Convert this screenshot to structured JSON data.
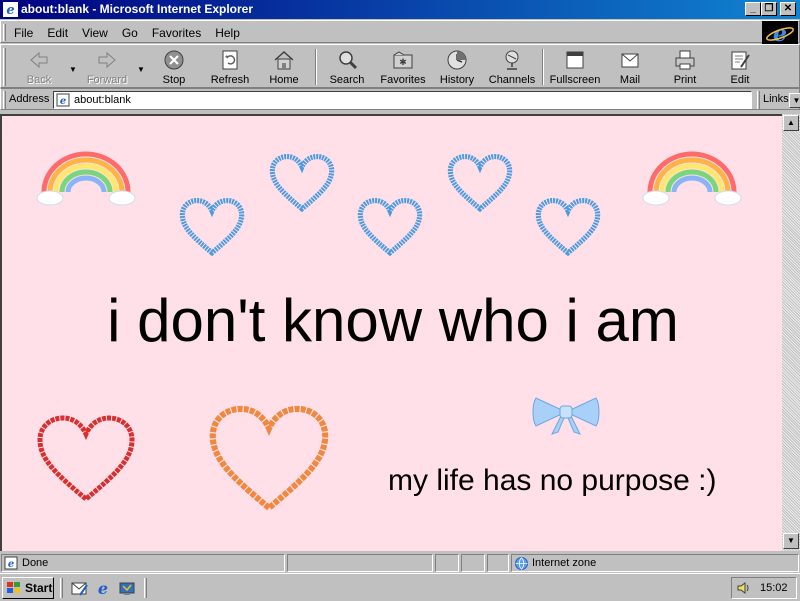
{
  "window": {
    "title": "about:blank - Microsoft Internet Explorer"
  },
  "menu": [
    {
      "label": "File"
    },
    {
      "label": "Edit"
    },
    {
      "label": "View"
    },
    {
      "label": "Go"
    },
    {
      "label": "Favorites"
    },
    {
      "label": "Help"
    }
  ],
  "toolbar": {
    "back": "Back",
    "forward": "Forward",
    "stop": "Stop",
    "refresh": "Refresh",
    "home": "Home",
    "search": "Search",
    "favorites": "Favorites",
    "history": "History",
    "channels": "Channels",
    "fullscreen": "Fullscreen",
    "mail": "Mail",
    "print": "Print",
    "edit": "Edit"
  },
  "address": {
    "label": "Address",
    "value": "about:blank",
    "links": "Links"
  },
  "page": {
    "headline": "i don't know who i am",
    "subline": "my life has no purpose :)"
  },
  "status": {
    "text": "Done",
    "zone": "Internet zone"
  },
  "taskbar": {
    "start": "Start",
    "clock": "15:02"
  },
  "colors": {
    "title_start": "#000080",
    "title_end": "#1084d0",
    "page_bg": "#ffe0e8",
    "heart_blue": "#4a9be0",
    "heart_red": "#d83030",
    "heart_orange": "#f08840",
    "bow": "#a8d0f8"
  },
  "icons": [
    "ie-icon",
    "minimize-icon",
    "maximize-icon",
    "close-icon",
    "back-arrow-icon",
    "forward-arrow-icon",
    "stop-icon",
    "refresh-icon",
    "home-icon",
    "search-icon",
    "favorites-icon",
    "history-icon",
    "channels-icon",
    "fullscreen-icon",
    "mail-icon",
    "print-icon",
    "edit-icon",
    "windows-logo-icon",
    "speaker-icon"
  ]
}
